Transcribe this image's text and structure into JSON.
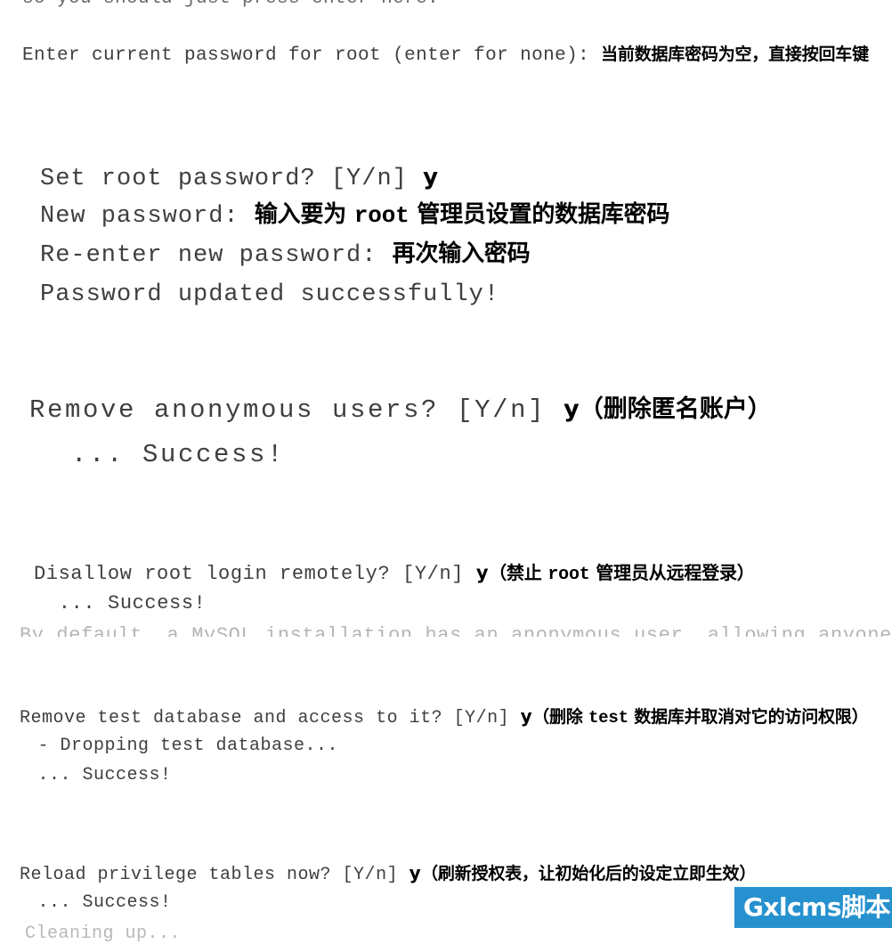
{
  "terminal": {
    "blocks": [
      {
        "id": "enter-current-password",
        "clipped_line": "so you should just press enter here.",
        "prompt": "Enter current password for root (enter for none): ",
        "annotation": "当前数据库密码为空，直接按回车键"
      },
      {
        "id": "set-root-password",
        "clipped_line": "............ ...... ..... ...",
        "lines": [
          {
            "prompt": "Set root password? [Y/n] ",
            "answer": "y",
            "annotation": ""
          },
          {
            "prompt": "New password: ",
            "answer": "",
            "annotation_pre": "输入要为 ",
            "annotation_mono": "root",
            "annotation_post": " 管理员设置的数据库密码"
          },
          {
            "prompt": "Re-enter new password: ",
            "answer": "",
            "annotation": "再次输入密码"
          },
          {
            "prompt": "Password updated successfully!",
            "answer": "",
            "annotation": ""
          }
        ]
      },
      {
        "id": "remove-anonymous-users",
        "lines": [
          {
            "prompt": "Remove anonymous users? [Y/n] ",
            "answer": "y",
            "annotation": "（删除匿名账户）"
          },
          {
            "prompt": " ... Success!",
            "answer": "",
            "annotation": ""
          }
        ]
      },
      {
        "id": "disallow-root-login-remotely",
        "clipped_top": "·                  ·",
        "clipped_bottom": "By default, a MySQL installation has an anonymous user, allowing anyone",
        "lines": [
          {
            "prompt": "Disallow root login remotely? [Y/n] ",
            "answer": "y",
            "annotation_pre": "（禁止 ",
            "annotation_mono": "root",
            "annotation_post": " 管理员从远程登录）"
          },
          {
            "prompt": " ... Success!",
            "answer": "",
            "annotation": ""
          }
        ]
      },
      {
        "id": "remove-test-database",
        "lines": [
          {
            "prompt": "Remove test database and access to it? [Y/n] ",
            "answer": "y",
            "annotation_pre": "（删除 ",
            "annotation_mono": "test",
            "annotation_post": " 数据库并取消对它的访问权限）"
          },
          {
            "prompt": " - Dropping test database...",
            "answer": "",
            "annotation": ""
          },
          {
            "prompt": " ... Success!",
            "answer": "",
            "annotation": ""
          }
        ]
      },
      {
        "id": "reload-privilege-tables",
        "clipped_bottom": "Cleaning up...",
        "lines": [
          {
            "prompt": "Reload privilege tables now? [Y/n] ",
            "answer": "y",
            "annotation": "（刷新授权表，让初始化后的设定立即生效）"
          },
          {
            "prompt": " ... Success!",
            "answer": "",
            "annotation": ""
          }
        ]
      }
    ]
  },
  "watermark": {
    "text": "Gxlcms脚本",
    "background_color": "#2691ce",
    "text_color": "#ffffff"
  },
  "colors": {
    "page_background": "#ffffff",
    "terminal_text": "#3f3f3f",
    "annotation_text": "#000000",
    "clipped_text": "#a8a8a8"
  }
}
